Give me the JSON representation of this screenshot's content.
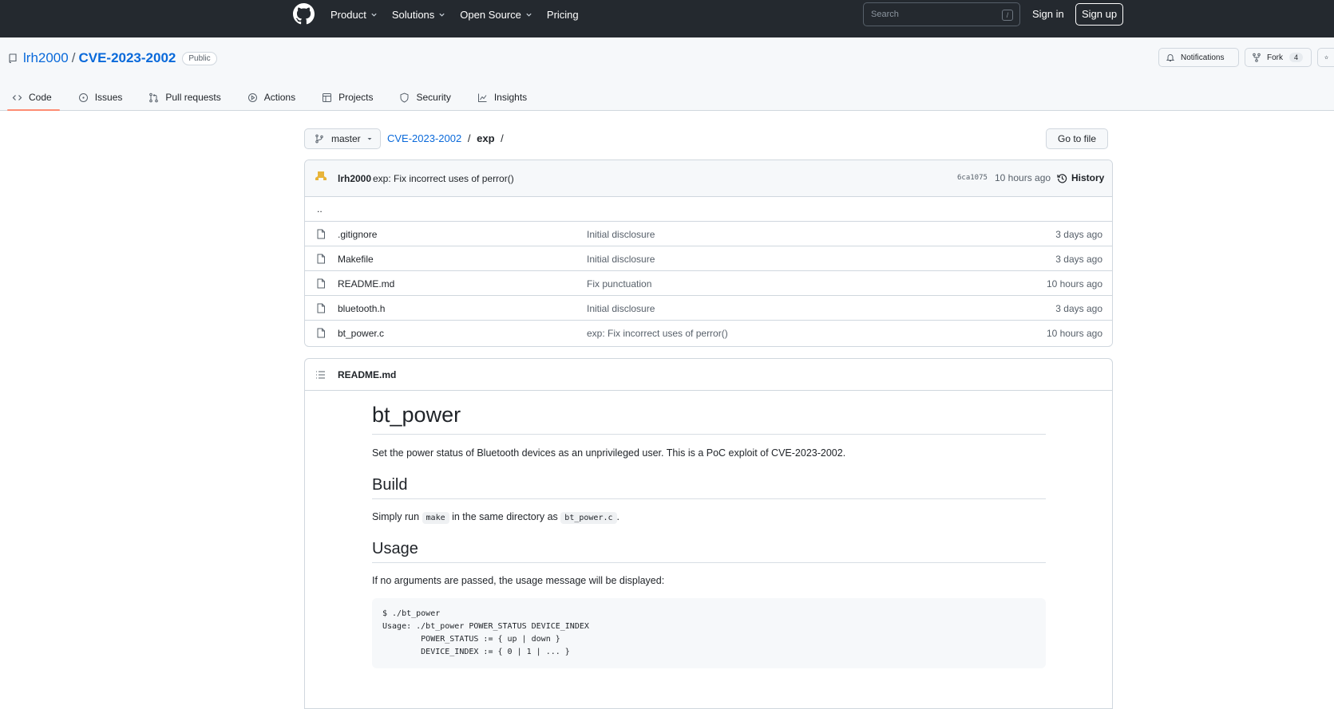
{
  "topnav": {
    "items": [
      {
        "label": "Product",
        "dropdown": true
      },
      {
        "label": "Solutions",
        "dropdown": true
      },
      {
        "label": "Open Source",
        "dropdown": true
      },
      {
        "label": "Pricing",
        "dropdown": false
      }
    ],
    "search_placeholder": "Search",
    "search_key": "/",
    "sign_in": "Sign in",
    "sign_up": "Sign up"
  },
  "repo": {
    "owner": "lrh2000",
    "separator": "/",
    "name": "CVE-2023-2002",
    "visibility": "Public",
    "notifications_label": "Notifications",
    "fork_label": "Fork",
    "fork_count": "4"
  },
  "tabs": [
    {
      "label": "Code",
      "icon": "code-icon",
      "active": true
    },
    {
      "label": "Issues",
      "icon": "issue-icon",
      "active": false
    },
    {
      "label": "Pull requests",
      "icon": "pull-request-icon",
      "active": false
    },
    {
      "label": "Actions",
      "icon": "play-icon",
      "active": false
    },
    {
      "label": "Projects",
      "icon": "table-icon",
      "active": false
    },
    {
      "label": "Security",
      "icon": "shield-icon",
      "active": false
    },
    {
      "label": "Insights",
      "icon": "graph-icon",
      "active": false
    }
  ],
  "breadcrumb": {
    "branch": "master",
    "root": "CVE-2023-2002",
    "sep": "/",
    "current": "exp",
    "trailing": "/"
  },
  "goto_file": "Go to file",
  "latest_commit": {
    "author": "lrh2000",
    "message": "exp: Fix incorrect uses of perror()",
    "sha": "6ca1075",
    "time": "10 hours ago",
    "history_label": "History"
  },
  "parent_dir": "..",
  "files": [
    {
      "name": ".gitignore",
      "commit": "Initial disclosure",
      "age": "3 days ago"
    },
    {
      "name": "Makefile",
      "commit": "Initial disclosure",
      "age": "3 days ago"
    },
    {
      "name": "README.md",
      "commit": "Fix punctuation",
      "age": "10 hours ago"
    },
    {
      "name": "bluetooth.h",
      "commit": "Initial disclosure",
      "age": "3 days ago"
    },
    {
      "name": "bt_power.c",
      "commit": "exp: Fix incorrect uses of perror()",
      "age": "10 hours ago"
    }
  ],
  "readme": {
    "file": "README.md",
    "h1": "bt_power",
    "intro": "Set the power status of Bluetooth devices as an unprivileged user. This is a PoC exploit of CVE-2023-2002.",
    "h2_build": "Build",
    "build_pre": "Simply run",
    "build_code1": "make",
    "build_mid": "in the same directory as",
    "build_code2": "bt_power.c",
    "build_post": ".",
    "h2_usage": "Usage",
    "usage_text": "If no arguments are passed, the usage message will be displayed:",
    "usage_code": "$ ./bt_power\nUsage: ./bt_power POWER_STATUS DEVICE_INDEX\n        POWER_STATUS := { up | down }\n        DEVICE_INDEX := { 0 | 1 | ... }"
  },
  "colors": {
    "header_bg": "#24292f",
    "link": "#0969da",
    "active_tab_underline": "#fd8c73",
    "border": "#d0d7de"
  }
}
